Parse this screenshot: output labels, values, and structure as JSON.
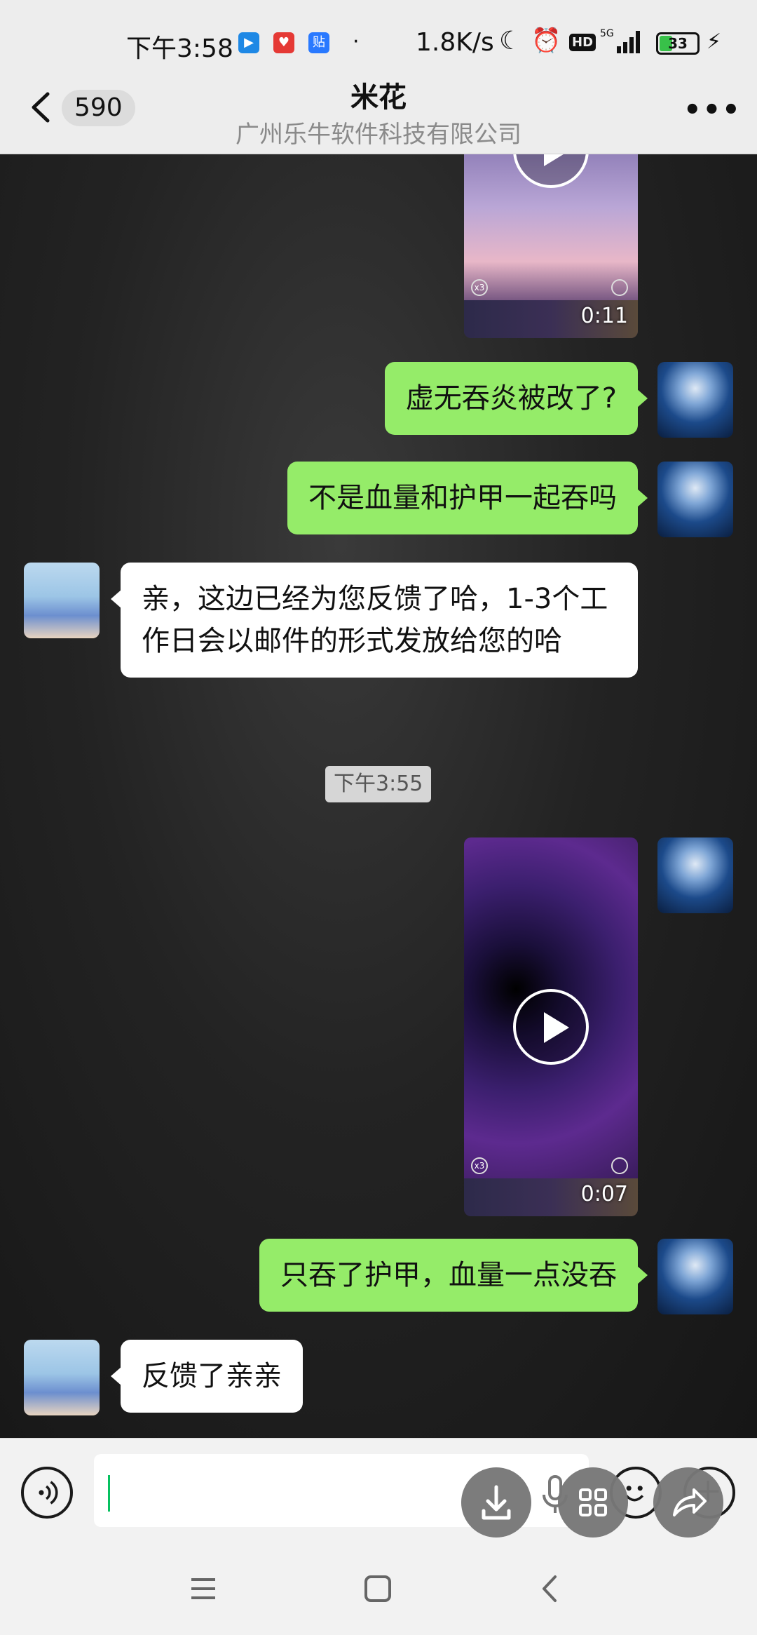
{
  "status_bar": {
    "time": "下午3:58",
    "separator": "·",
    "network_speed": "1.8K/s",
    "hd_label": "HD",
    "network_type": "5G",
    "battery_level": "33",
    "icons": [
      "video-app-icon",
      "store-app-icon",
      "tieba-app-icon",
      "moon-icon",
      "alarm-icon",
      "signal-icon",
      "battery-icon",
      "charging-icon"
    ]
  },
  "header": {
    "unread_count": "590",
    "contact_name": "米花",
    "company": "广州乐牛软件科技有限公司"
  },
  "messages": [
    {
      "type": "video",
      "side": "sent",
      "duration": "0:11",
      "mini_label": "x3"
    },
    {
      "type": "text",
      "side": "sent",
      "text": "虚无吞炎被改了?"
    },
    {
      "type": "text",
      "side": "sent",
      "text": "不是血量和护甲一起吞吗"
    },
    {
      "type": "text",
      "side": "received",
      "text": "亲，这边已经为您反馈了哈，1-3个工作日会以邮件的形式发放给您的哈"
    },
    {
      "type": "timestamp",
      "text": "下午3:55"
    },
    {
      "type": "video",
      "side": "sent",
      "duration": "0:07",
      "mini_label": "x3"
    },
    {
      "type": "text",
      "side": "sent",
      "text": "只吞了护甲，血量一点没吞"
    },
    {
      "type": "text",
      "side": "received",
      "text": "反馈了亲亲"
    }
  ],
  "colors": {
    "sent_bubble": "#95ec69",
    "received_bubble": "#ffffff",
    "header_bg": "#ededed",
    "cursor": "#07c160"
  }
}
